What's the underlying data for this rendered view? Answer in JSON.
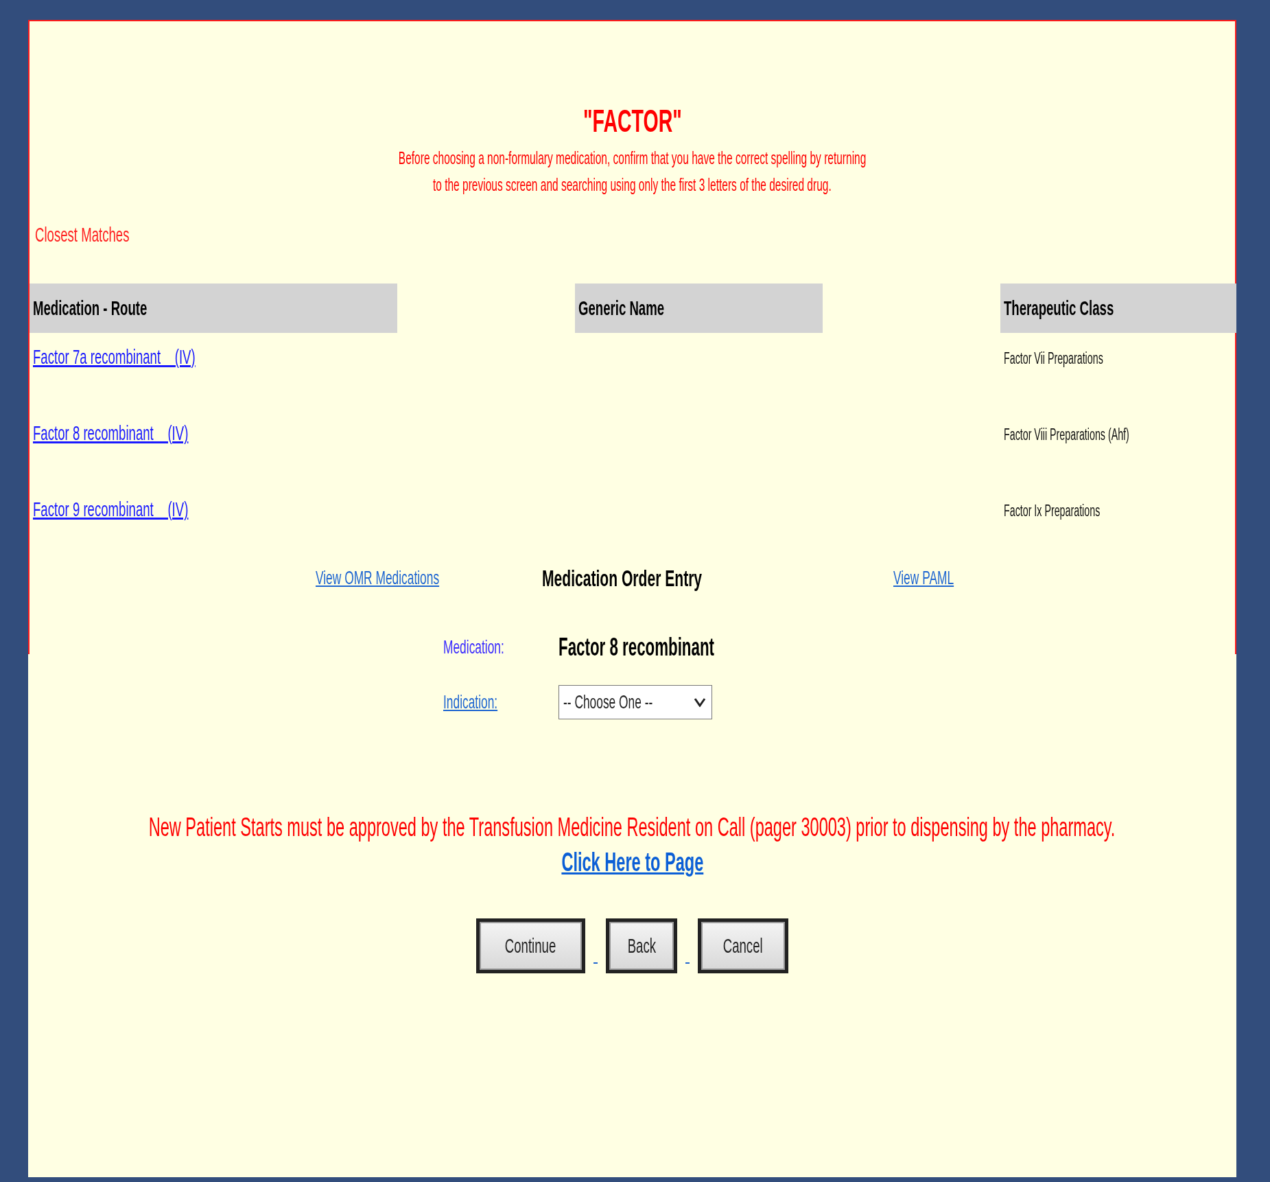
{
  "title": "\"FACTOR\"",
  "notice_lines": [
    "Before choosing a non-formulary medication, confirm that you have the correct spelling by returning",
    "to the previous screen and searching using only the first 3 letters of the desired drug."
  ],
  "closest_matches_label": "Closest Matches",
  "table": {
    "columns": [
      "Medication - Route",
      "Generic Name",
      "Therapeutic Class"
    ],
    "rows": [
      {
        "medication_route": "Factor 7a recombinant    (IV)",
        "therapeutic_class": "Factor Vii Preparations"
      },
      {
        "medication_route": "Factor 8 recombinant    (IV)",
        "therapeutic_class": "Factor Viii Preparations (Ahf)"
      },
      {
        "medication_route": "Factor 9 recombinant    (IV)",
        "therapeutic_class": "Factor Ix Preparations"
      }
    ]
  },
  "order_entry": {
    "omr_link": "View OMR Medications",
    "title": "Medication Order Entry",
    "paml_link": "View PAML",
    "medication_label": "Medication:",
    "medication": "Factor 8 recombinant",
    "indication_label": "Indication:",
    "indication_select": {
      "value": "-- Choose One --"
    }
  },
  "approval_notice": "New Patient Starts must be approved by the Transfusion Medicine Resident on Call (pager 30003) prior to dispensing by the pharmacy.",
  "page_link": "Click Here to Page",
  "buttons": [
    "Continue",
    "Back",
    "Cancel"
  ]
}
